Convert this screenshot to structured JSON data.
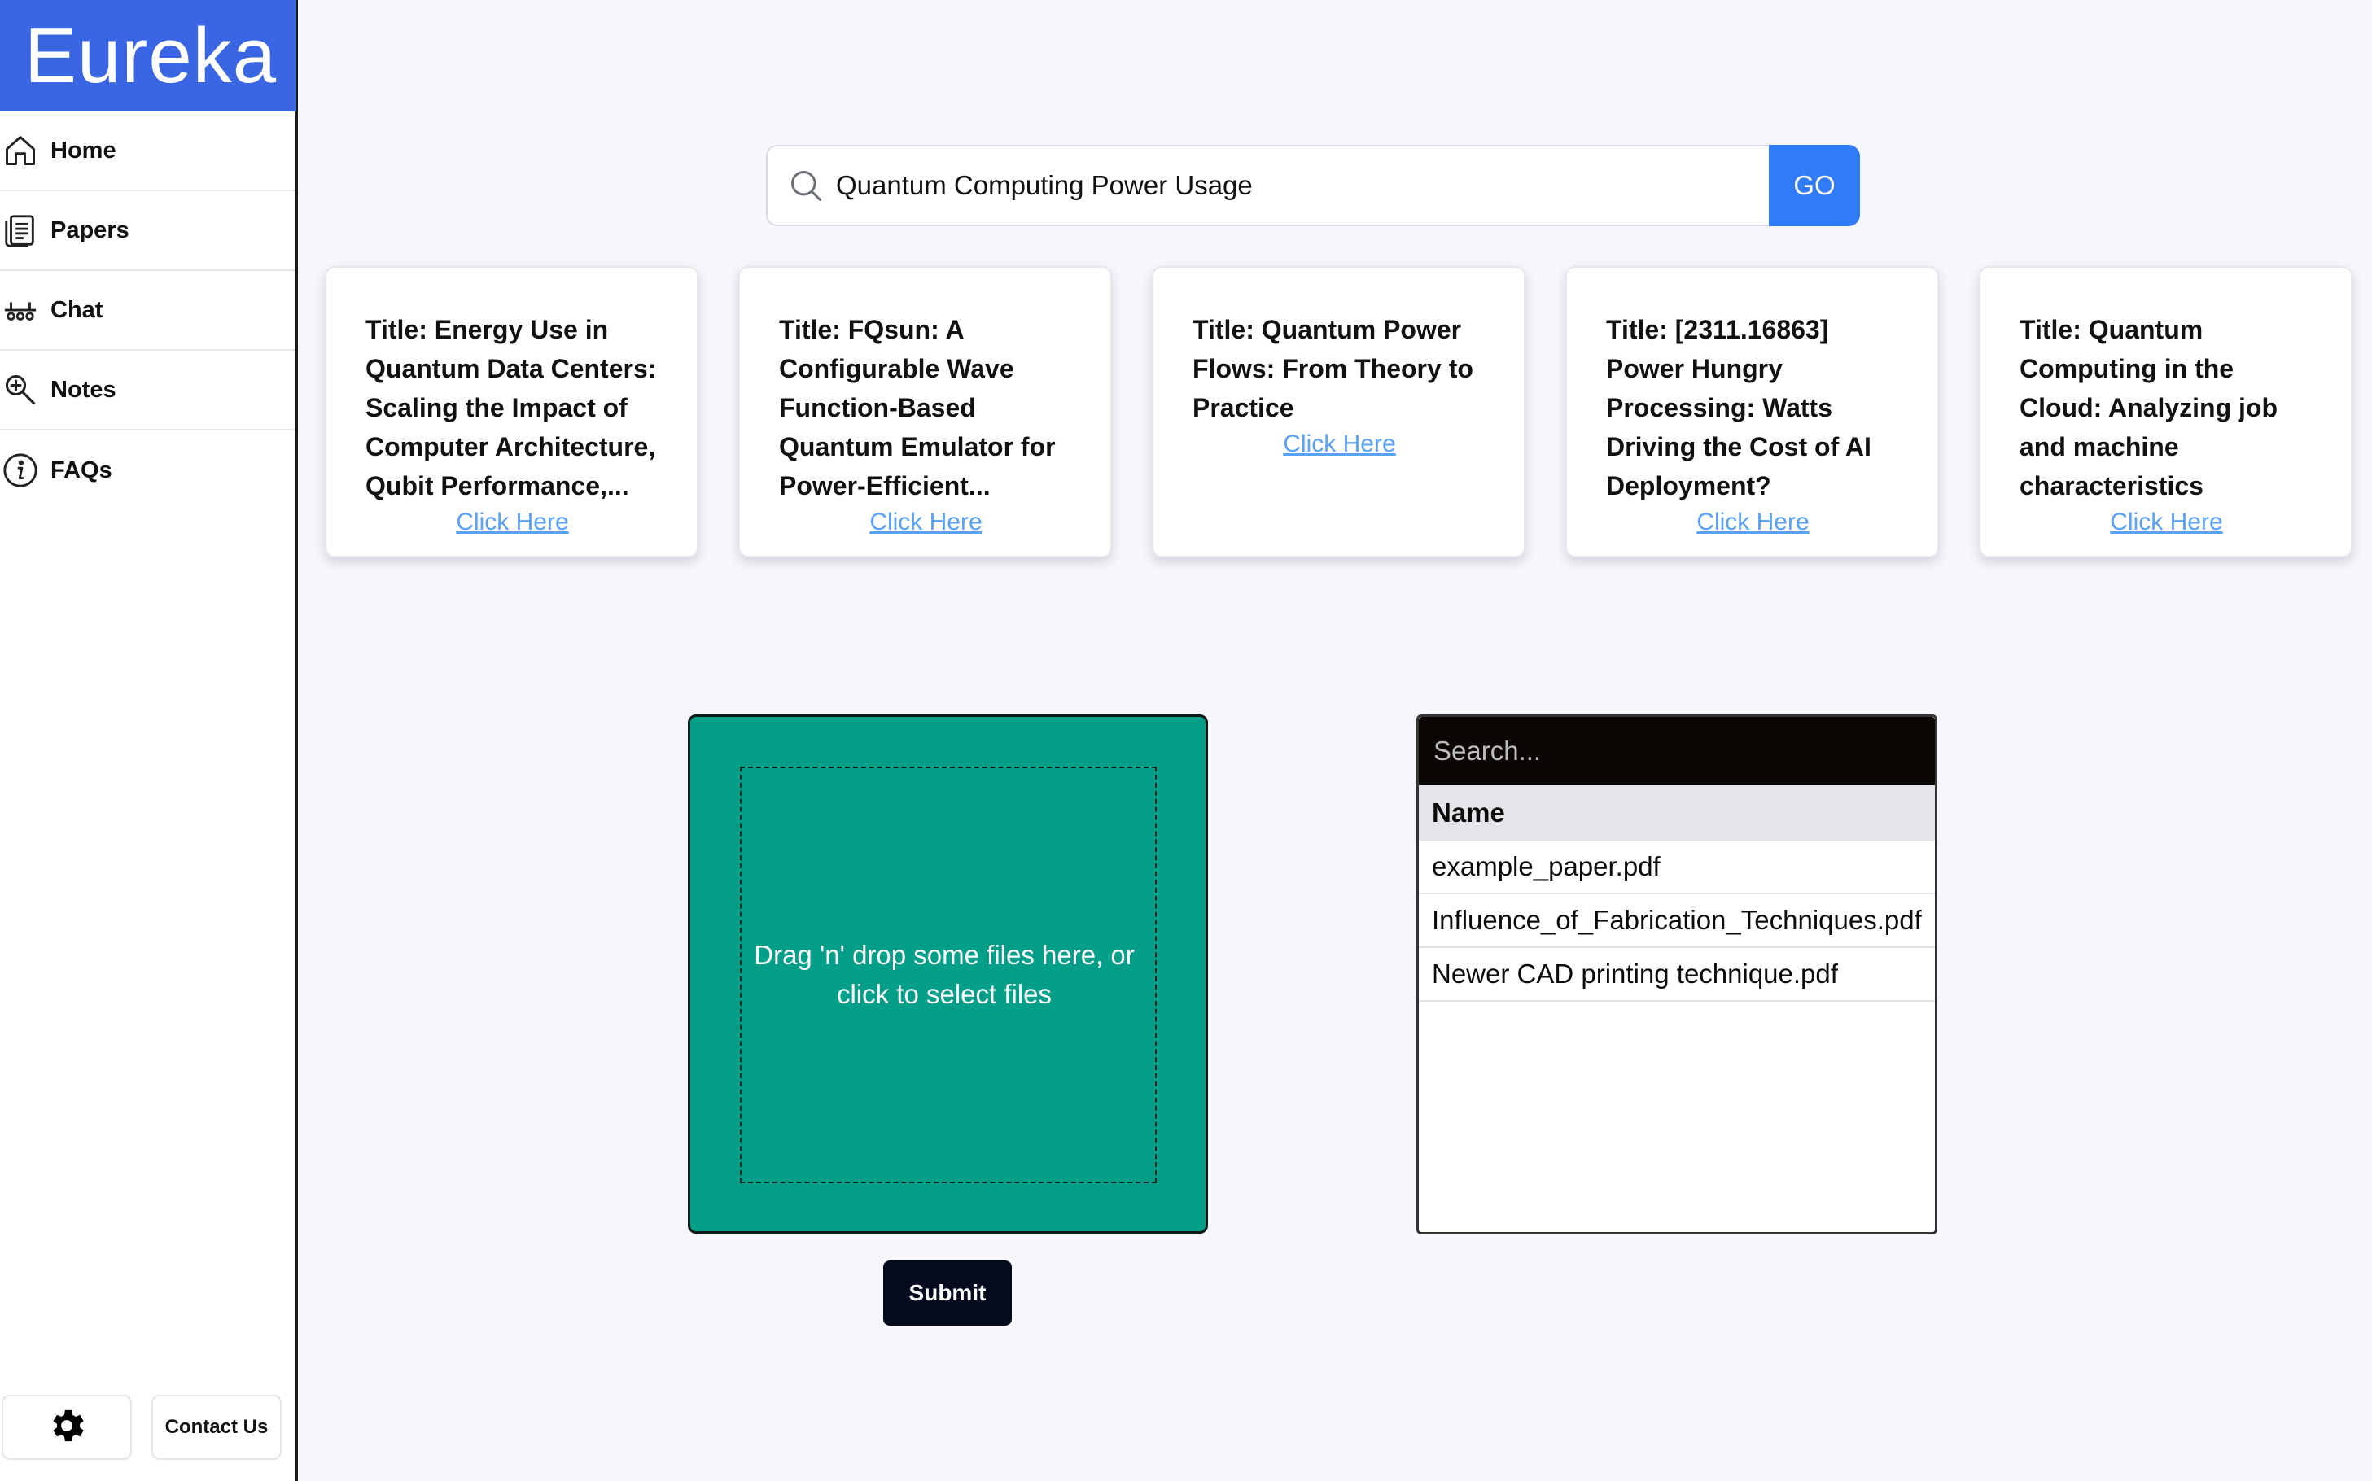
{
  "app": {
    "title": "Eureka"
  },
  "sidebar": {
    "items": [
      {
        "label": "Home",
        "icon": "home-icon"
      },
      {
        "label": "Papers",
        "icon": "papers-icon"
      },
      {
        "label": "Chat",
        "icon": "chat-icon"
      },
      {
        "label": "Notes",
        "icon": "notes-icon"
      },
      {
        "label": "FAQs",
        "icon": "info-icon"
      }
    ],
    "settings_icon": "gear-icon",
    "contact_label": "Contact Us"
  },
  "search": {
    "query": "Quantum Computing Power Usage",
    "button_label": "GO"
  },
  "results": [
    {
      "title": "Title: Energy Use in Quantum Data Centers: Scaling the Impact of Computer Architecture, Qubit Performance,...",
      "link": "Click Here"
    },
    {
      "title": "Title: FQsun: A Configurable Wave Function-Based Quantum Emulator for Power-Efficient...",
      "link": "Click Here"
    },
    {
      "title": "Title: Quantum Power Flows: From Theory to Practice",
      "link": "Click Here"
    },
    {
      "title": "Title: [2311.16863] Power Hungry Processing: Watts Driving the Cost of AI Deployment?",
      "link": "Click Here"
    },
    {
      "title": "Title: Quantum Computing in the Cloud: Analyzing job and machine characteristics",
      "link": "Click Here"
    }
  ],
  "upload": {
    "dropzone_text": "Drag 'n' drop some files here, or click to select files",
    "submit_label": "Submit"
  },
  "files": {
    "search_placeholder": "Search...",
    "column_header": "Name",
    "rows": [
      "example_paper.pdf",
      "Influence_of_Fabrication_Techniques.pdf",
      "Newer CAD printing technique.pdf"
    ]
  },
  "colors": {
    "brand": "#3b66e3",
    "go_button": "#2f7cf6",
    "dropzone": "#049e89",
    "link": "#5aa2f7",
    "submit": "#050b1f"
  }
}
